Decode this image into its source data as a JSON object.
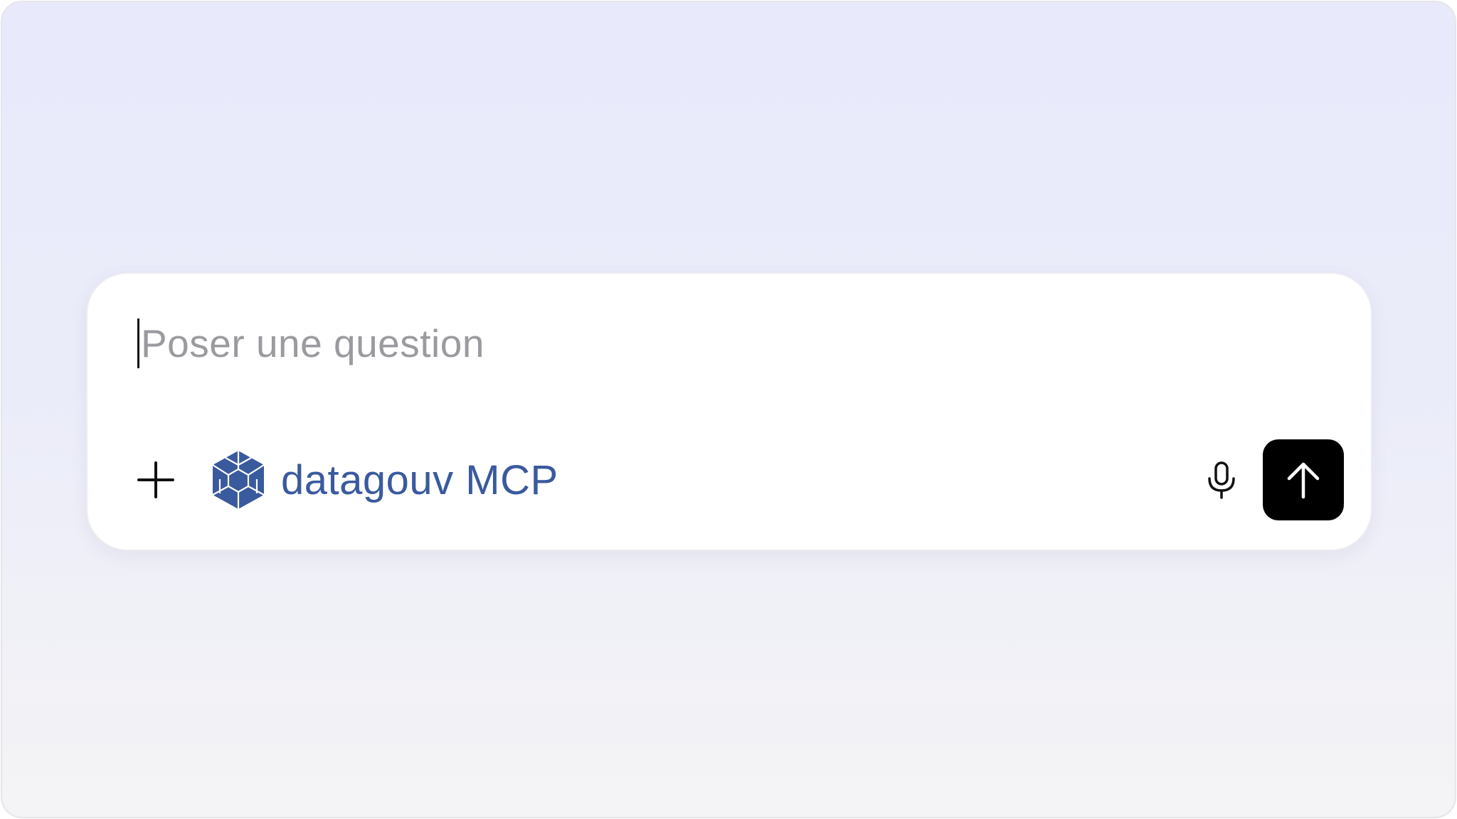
{
  "composer": {
    "placeholder": "Poser une question",
    "value": ""
  },
  "toolbar": {
    "add_icon": "plus-icon",
    "tool": {
      "label": "datagouv MCP",
      "icon": "datagouv-cube-logo",
      "color": "#3a5a9e"
    },
    "mic_icon": "microphone-icon",
    "send_icon": "arrow-up-icon",
    "send_color": "#000000"
  }
}
